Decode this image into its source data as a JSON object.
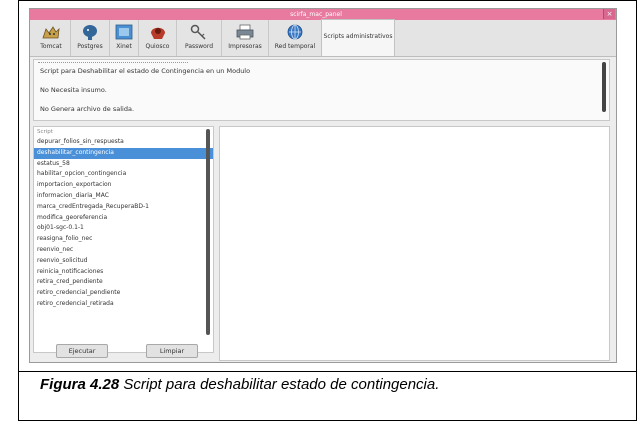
{
  "window": {
    "title": "scirfa_mac_panel"
  },
  "toolbar": {
    "items": [
      {
        "label": "Tomcat",
        "icon": "cat-icon"
      },
      {
        "label": "Postgres",
        "icon": "elephant-icon"
      },
      {
        "label": "Xinet",
        "icon": "xinet-icon"
      },
      {
        "label": "Quiosco",
        "icon": "kiosk-icon"
      },
      {
        "label": "Password",
        "icon": "key-icon"
      },
      {
        "label": "Impresoras",
        "icon": "printer-icon"
      },
      {
        "label": "Red temporal",
        "icon": "network-icon"
      },
      {
        "label": "Scripts administrativos",
        "icon": ""
      }
    ]
  },
  "info": {
    "line1": "Script para Deshabilitar el estado de Contingencia en un Modulo",
    "line2": "No Necesita insumo.",
    "line3": "No Genera archivo de salida."
  },
  "script_list": {
    "header": "Script",
    "items": [
      "depurar_folios_sin_respuesta",
      "deshabilitar_contingencia",
      "estatus_58",
      "habilitar_opcion_contingencia",
      "importacion_exportacion",
      "informacion_diaria_MAC",
      "marca_credEntregada_RecuperaBD-1",
      "modifica_georeferencia",
      "obj01-sgc-0.1-1",
      "reasigna_folio_nec",
      "reenvio_nec",
      "reenvio_solicitud",
      "reinicia_notificaciones",
      "retira_cred_pendiente",
      "retiro_credencial_pendiente",
      "retiro_credencial_retirada"
    ],
    "selected": "deshabilitar_contingencia"
  },
  "buttons": {
    "execute": "Ejecutar",
    "clear": "Limpiar"
  },
  "caption": {
    "label": "Figura 4.28",
    "text": " Script para deshabilitar estado de contingencia."
  },
  "colors": {
    "titlebar": "#e87aa0",
    "selection": "#4a90d9"
  }
}
